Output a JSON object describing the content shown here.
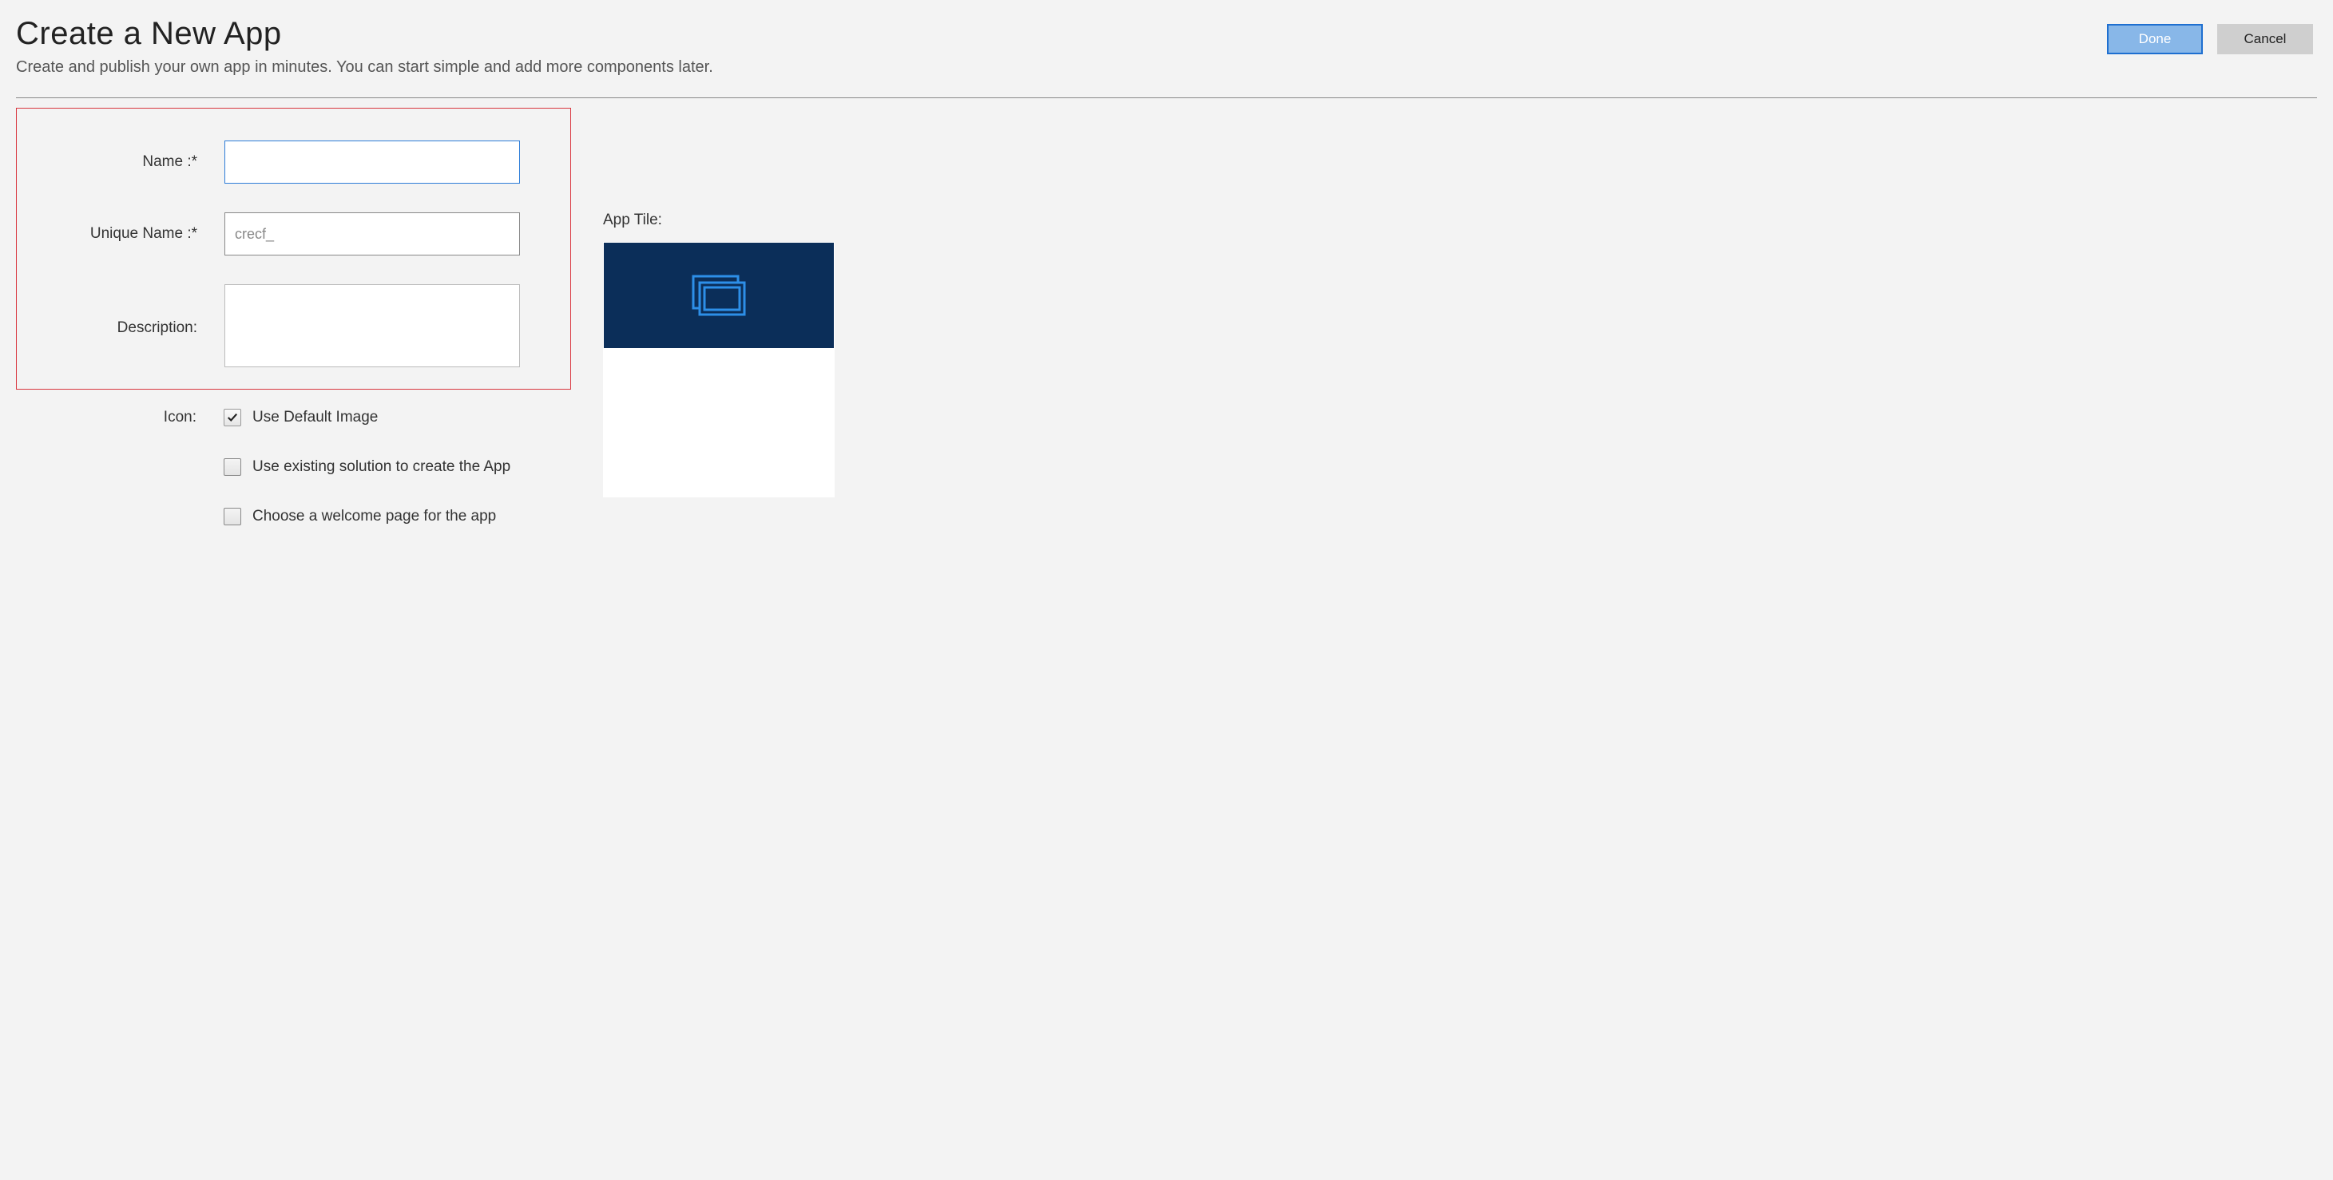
{
  "header": {
    "title": "Create a New App",
    "subtitle": "Create and publish your own app in minutes. You can start simple and add more components later.",
    "done_label": "Done",
    "cancel_label": "Cancel"
  },
  "form": {
    "name_label": "Name :*",
    "name_value": "",
    "unique_name_label": "Unique Name :*",
    "unique_name_value": "crecf_",
    "description_label": "Description:",
    "description_value": "",
    "icon_label": "Icon:",
    "use_default_image_label": "Use Default Image",
    "use_default_image_checked": true,
    "use_existing_solution_label": "Use existing solution to create the App",
    "use_existing_solution_checked": false,
    "choose_welcome_label": "Choose a welcome page for the app",
    "choose_welcome_checked": false
  },
  "app_tile": {
    "label": "App Tile:"
  }
}
